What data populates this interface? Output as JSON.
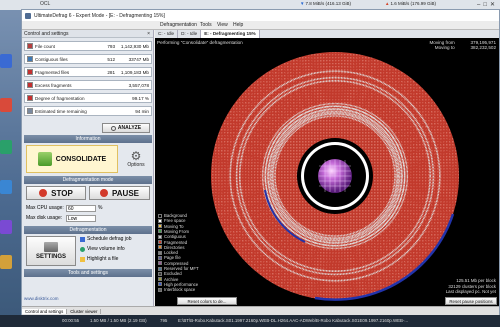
{
  "window": {
    "title": "UltimateDefrag 6 - Expert Mode - [E: - Defragmenting 15%]",
    "menu": [
      "Defragmentation",
      "Tools",
      "View",
      "Help"
    ]
  },
  "topbar": {
    "left_label": "OCL",
    "net_down": "7.8 MiB/s (416.13 GiB)",
    "net_up": "1.6 MiB/s (176.99 GiB)"
  },
  "left_panel": {
    "header": "Control and settings",
    "stats": [
      {
        "label": "File count",
        "count": "793",
        "size": "1,142,930 Mb",
        "color": "#b53f3f"
      },
      {
        "label": "Contiguous files",
        "count": "512",
        "size": "33747 Mb",
        "color": "#3f7ab5"
      },
      {
        "label": "Fragmented files",
        "count": "281",
        "size": "1,109,183 Mb",
        "color": "#c43030"
      },
      {
        "label": "Excess fragments",
        "count": "",
        "size": "3,557,078",
        "color": "#c43030"
      },
      {
        "label": "Degree of fragmentation",
        "count": "",
        "size": "99.17 %",
        "color": "#c43030"
      },
      {
        "label": "Estimated time remaining",
        "count": "",
        "size": "94 min",
        "color": "#7a8aa0"
      }
    ],
    "analyze_label": "ANALYZE",
    "information_header": "Information",
    "consolidate_label": "CONSOLIDATE",
    "options_label": "Options",
    "defrag_mode_header": "Defragmentation mode",
    "stop_label": "STOP",
    "pause_label": "PAUSE",
    "max_cpu_label": "Max CPU usage:",
    "max_cpu_value": "60",
    "max_cpu_unit": "%",
    "max_disk_label": "Max disk usage:",
    "max_disk_value": "Low",
    "defragmentation_header": "Defragmentation",
    "schedule_label": "Schedule defrag job",
    "view_volume_label": "View volume info",
    "highlight_label": "Highlight a file",
    "settings_label": "SETTINGS",
    "tools_header": "Tools and settings",
    "footer_url": "www.disktrix.com"
  },
  "right_panel": {
    "tabs": [
      {
        "label": "C: - Idle",
        "active": false
      },
      {
        "label": "D: - Idle",
        "active": false
      },
      {
        "label": "E: - Defragmenting 15%",
        "active": true
      }
    ],
    "status_text": "Performing \"Consolidate\" defragmentation",
    "moving_from_label": "Moving from",
    "moving_from_value": "379,195,971",
    "moving_to_label": "Moving to",
    "moving_to_value": "382,232,502",
    "legend": [
      {
        "label": "Background",
        "color": "#000000"
      },
      {
        "label": "Free space",
        "color": "#ffffff"
      },
      {
        "label": "Moving To",
        "color": "#f5c542"
      },
      {
        "label": "Moving From",
        "color": "#3fa04a"
      },
      {
        "label": "Contiguous",
        "color": "#c8c8c8"
      },
      {
        "label": "Fragmented",
        "color": "#d23a2a"
      },
      {
        "label": "Directories",
        "color": "#e48a2a"
      },
      {
        "label": "Locked",
        "color": "#808080"
      },
      {
        "label": "Page file",
        "color": "#5a5a9a"
      },
      {
        "label": "Compressed",
        "color": "#9a5a9a"
      },
      {
        "label": "Reserved for MFT",
        "color": "#4a7a9a"
      },
      {
        "label": "Excluded",
        "color": "#3a3a3a"
      },
      {
        "label": "Archive",
        "color": "#9a9a3a"
      },
      {
        "label": "High performance",
        "color": "#3a5ad2"
      },
      {
        "label": "Interblock space",
        "color": "#606060"
      }
    ],
    "mb_per_block": "125.51 Mb per block",
    "clusters_per_block": "32129 clusters per block",
    "last_displayed": "Last displayed pc. Not yet",
    "reset_colors_label": "Reset colors to de...",
    "reset_pause_label": "Reset pause positions"
  },
  "statusbar": {
    "tabs": [
      "Control and settings",
      "Cluster viewer"
    ],
    "speed": "00:00:55",
    "transfer": "1.50 MB / 1.50 MB (2.19 GB)",
    "count": "795",
    "file_path": "E:\\BT\\B-Robo.Kabutack.S01.1997.2160p.WEB-DL.H264.AAC-ADWeb\\B-Robo Kabutack.S01E09.1997.2160p.WEB-..."
  },
  "colors": {
    "accent": "#4f6c93",
    "fragmented": "#c23a2a",
    "free": "#dfdfdf",
    "high_performance": "#2233aa"
  }
}
